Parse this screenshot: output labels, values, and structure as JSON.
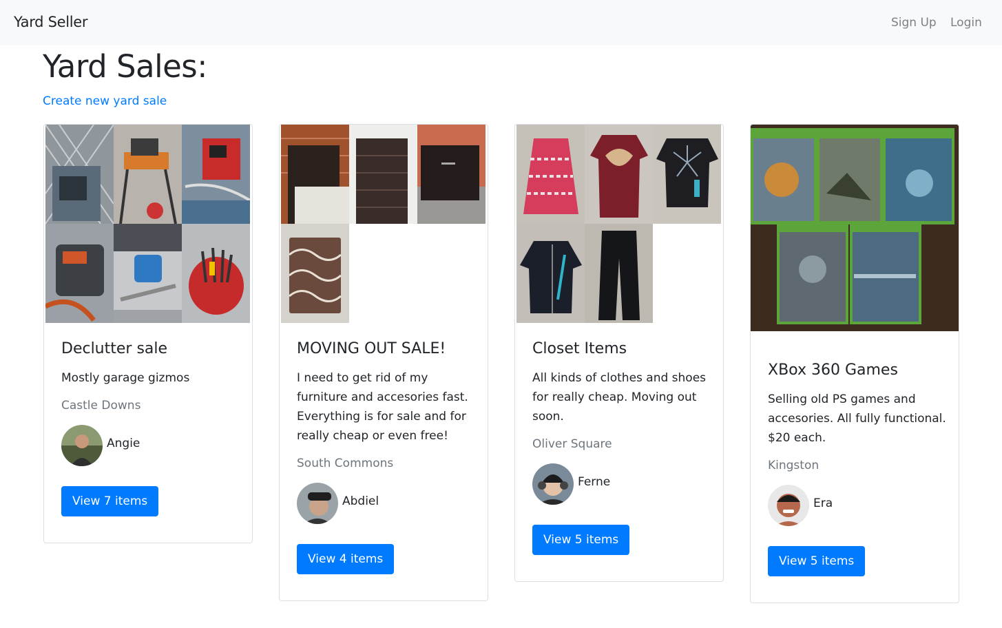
{
  "navbar": {
    "brand": "Yard Seller",
    "signup": "Sign Up",
    "login": "Login"
  },
  "page": {
    "title": "Yard Sales:",
    "create_link": "Create new yard sale"
  },
  "colors": {
    "accent": "#007bff",
    "navbar_bg": "#f8f9fa",
    "muted": "#6c757d"
  },
  "sales": [
    {
      "title": "Declutter sale",
      "description": "Mostly garage gizmos",
      "location": "Castle Downs",
      "seller": "Angie",
      "button": "View 7 items"
    },
    {
      "title": "MOVING OUT SALE!",
      "description": "I need to get rid of my furniture and accesories fast. Everything is for sale and for really cheap or even free!",
      "location": "South Commons",
      "seller": "Abdiel",
      "button": "View 4 items"
    },
    {
      "title": "Closet Items",
      "description": "All kinds of clothes and shoes for really cheap. Moving out soon.",
      "location": "Oliver Square",
      "seller": "Ferne",
      "button": "View 5 items"
    },
    {
      "title": "XBox 360 Games",
      "description": "Selling old PS games and accesories. All fully functional. $20 each.",
      "location": "Kingston",
      "seller": "Era",
      "button": "View 5 items"
    }
  ]
}
